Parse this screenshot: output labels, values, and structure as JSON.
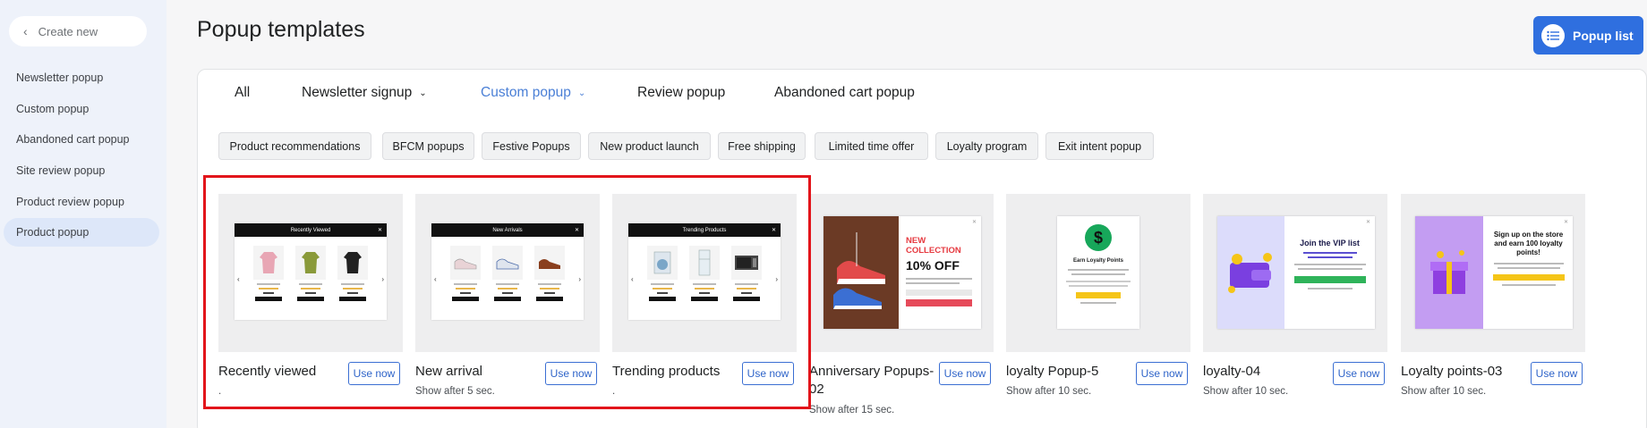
{
  "sidebar": {
    "create_new": "Create new",
    "items": [
      {
        "label": "Newsletter popup",
        "active": false
      },
      {
        "label": "Custom popup",
        "active": false
      },
      {
        "label": "Abandoned cart popup",
        "active": false
      },
      {
        "label": "Site review popup",
        "active": false
      },
      {
        "label": "Product review popup",
        "active": false
      },
      {
        "label": "Product popup",
        "active": true
      }
    ]
  },
  "header": {
    "title": "Popup templates",
    "popup_list_label": "Popup list"
  },
  "tabs": [
    {
      "label": "All",
      "active": false,
      "dropdown": false
    },
    {
      "label": "Newsletter signup",
      "active": false,
      "dropdown": true
    },
    {
      "label": "Custom popup",
      "active": true,
      "dropdown": true
    },
    {
      "label": "Review popup",
      "active": false,
      "dropdown": false
    },
    {
      "label": "Abandoned cart popup",
      "active": false,
      "dropdown": false
    }
  ],
  "chips": [
    "Product recommendations",
    "BFCM popups",
    "Festive Popups",
    "New product launch",
    "Free shipping",
    "Limited time offer",
    "Loyalty program",
    "Exit intent popup"
  ],
  "use_now_label": "Use now",
  "templates": [
    {
      "title": "Recently viewed",
      "subtitle": ".",
      "popup_header": "Recently Viewed"
    },
    {
      "title": "New arrival",
      "subtitle": "Show after 5 sec.",
      "popup_header": "New Arrivals"
    },
    {
      "title": "Trending products",
      "subtitle": ".",
      "popup_header": "Trending Products"
    },
    {
      "title": "Anniversary Popups-02",
      "subtitle": "Show after 15 sec.",
      "banner_heading": "NEW COLLECTION",
      "banner_offer": "10% OFF"
    },
    {
      "title": "loyalty Popup-5",
      "subtitle": "Show after 10 sec.",
      "banner_heading": "Earn Loyalty Points",
      "banner_symbol": "$"
    },
    {
      "title": "loyalty-04",
      "subtitle": "Show after 10 sec.",
      "banner_heading": "Join the VIP list"
    },
    {
      "title": "Loyalty points-03",
      "subtitle": "Show after 10 sec.",
      "banner_heading": "Sign up on the store and earn 100 loyalty points!"
    }
  ],
  "colors": {
    "accent": "#2f6fdf",
    "active_tab": "#4a7fd6",
    "highlight_box": "#e2151b",
    "sidebar_bg": "#eef2fa"
  }
}
